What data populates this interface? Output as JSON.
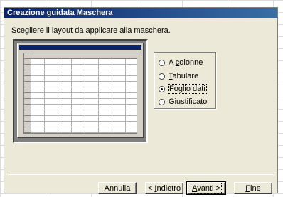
{
  "window": {
    "title": "Creazione guidata Maschera"
  },
  "instruction": "Scegliere il layout da applicare alla maschera.",
  "layout_options": [
    {
      "label_pre": "A ",
      "label_ul": "c",
      "label_post": "olonne",
      "selected": false
    },
    {
      "label_pre": "",
      "label_ul": "T",
      "label_post": "abulare",
      "selected": false
    },
    {
      "label_pre": "Foglio ",
      "label_ul": "d",
      "label_post": "ati",
      "selected": true
    },
    {
      "label_pre": "",
      "label_ul": "G",
      "label_post": "iustificato",
      "selected": false
    }
  ],
  "buttons": {
    "cancel": "Annulla",
    "back_pre": "< ",
    "back_ul": "I",
    "back_post": "ndietro",
    "next_ul": "A",
    "next_post": "vanti >",
    "finish_ul": "F",
    "finish_post": "ine"
  },
  "colors": {
    "titlebar": "#0a246a",
    "dialog_bg": "#ece9d8"
  }
}
